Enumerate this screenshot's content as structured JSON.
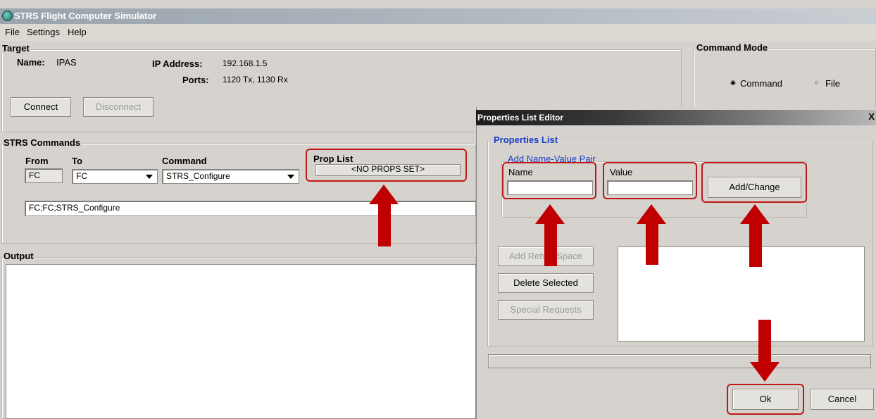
{
  "window": {
    "title": "STRS Flight Computer Simulator"
  },
  "menu": [
    "File",
    "Settings",
    "Help"
  ],
  "target": {
    "group_label": "Target",
    "name_label": "Name:",
    "name_value": "IPAS",
    "ip_label": "IP Address:",
    "ip_value": "192.168.1.5",
    "ports_label": "Ports:",
    "ports_value": "1120 Tx, 1130 Rx",
    "connect_label": "Connect",
    "disconnect_label": "Disconnect"
  },
  "command_mode": {
    "group_label": "Command Mode",
    "command_label": "Command",
    "file_label": "File",
    "selected": "Command"
  },
  "strs_commands": {
    "group_label": "STRS Commands",
    "from_label": "From",
    "to_label": "To",
    "command_label": "Command",
    "from_value": "FC",
    "to_value": "FC",
    "command_value": "STRS_Configure",
    "prop_list_label": "Prop List",
    "prop_list_button": "<NO PROPS SET>",
    "command_string": "FC;FC;STRS_Configure"
  },
  "output": {
    "group_label": "Output"
  },
  "dialog": {
    "title": "Properties List Editor",
    "close_label": "X",
    "properties_list_label": "Properties List",
    "pair_label": "Add Name-Value Pair",
    "name_label": "Name",
    "value_label": "Value",
    "name_value": "",
    "value_value": "",
    "add_change_label": "Add/Change",
    "add_retval_label": "Add Retval Space",
    "delete_selected_label": "Delete Selected",
    "special_requests_label": "Special Requests",
    "ok_label": "Ok",
    "cancel_label": "Cancel"
  },
  "colors": {
    "annotation_red": "#c00000",
    "group_blue": "#1a3ec8"
  }
}
